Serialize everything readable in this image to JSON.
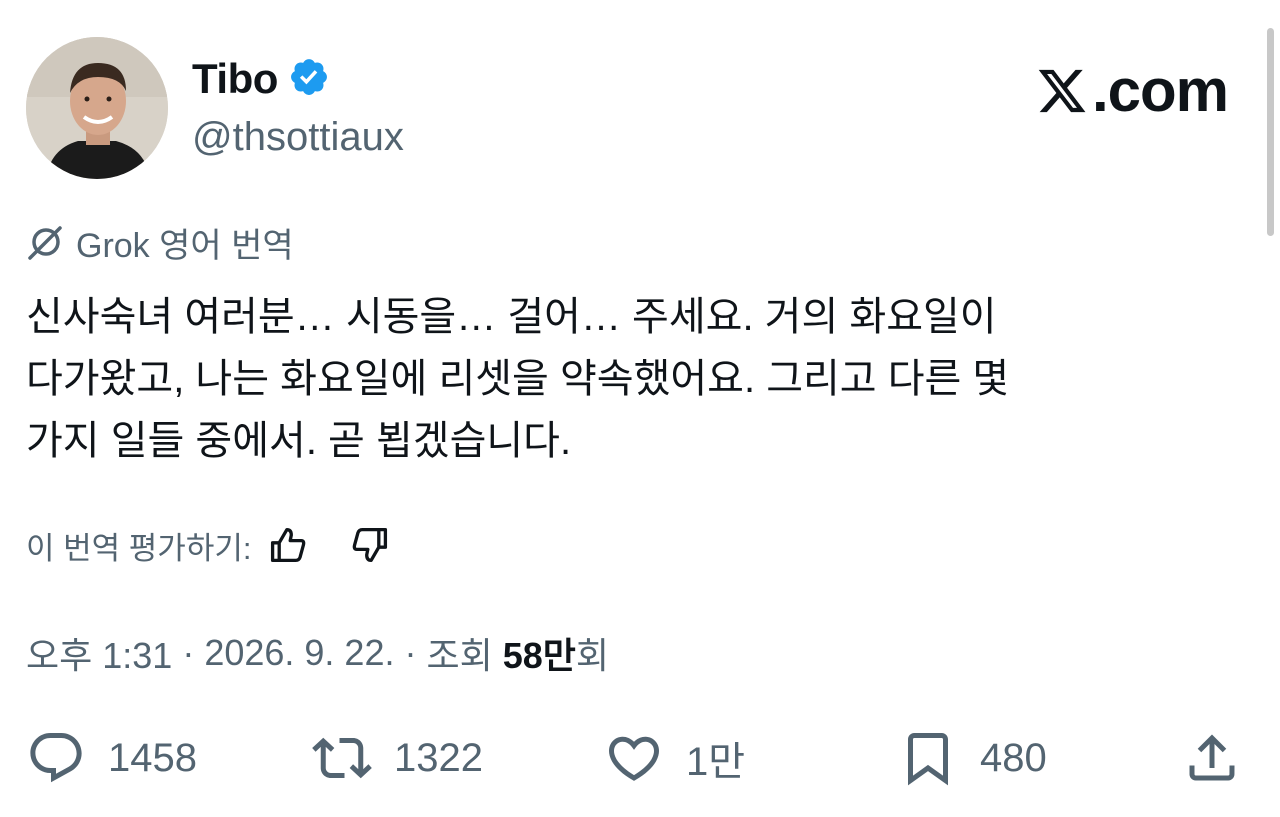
{
  "author": {
    "name": "Tibo",
    "handle": "@thsottiaux",
    "verified": true,
    "verified_color": "#1d9bf0"
  },
  "brand": {
    "domain": ".com"
  },
  "translation": {
    "label": "Grok 영어 번역"
  },
  "tweet": {
    "text": "신사숙녀 여러분… 시동을… 걸어… 주세요. 거의 화요일이\n다가왔고, 나는 화요일에 리셋을 약속했어요. 그리고 다른 몇\n가지 일들 중에서. 곧 뵙겠습니다."
  },
  "rating": {
    "prompt": "이 번역 평가하기:",
    "up_icon": "thumbs-up-icon",
    "down_icon": "thumbs-down-icon"
  },
  "meta": {
    "time": "오후 1:31",
    "separator": " · ",
    "date": "2026. 9. 22.",
    "views_label": "조회 ",
    "views_num": "58만",
    "views_suffix": "회"
  },
  "actions": {
    "replies": "1458",
    "reposts": "1322",
    "likes": "1만",
    "bookmarks": "480"
  },
  "colors": {
    "text": "#0f1419",
    "secondary": "#536471",
    "background": "#ffffff"
  }
}
